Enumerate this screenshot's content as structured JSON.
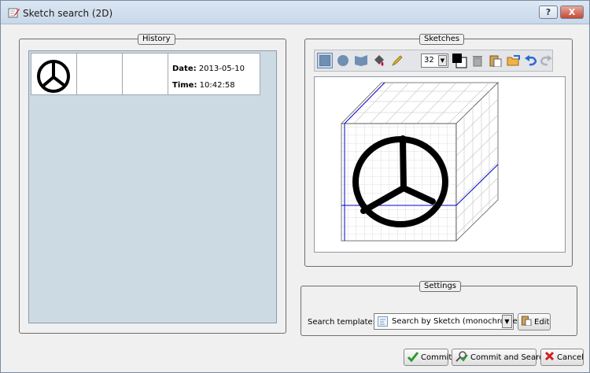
{
  "window": {
    "title": "Sketch search (2D)",
    "help_label": "?",
    "close_label": "X"
  },
  "history": {
    "title": "History",
    "items": [
      {
        "date_label": "Date:",
        "date": "2013-05-10",
        "time_label": "Time:",
        "time": "10:42:58"
      }
    ]
  },
  "sketches": {
    "title": "Sketches",
    "toolbar": {
      "tools": [
        "rectangle-tool-icon",
        "ellipse-tool-icon",
        "flag-tool-icon",
        "fill-bucket-icon",
        "pencil-icon",
        "color-picker-icon",
        "trash-icon",
        "paste-icon",
        "open-folder-icon",
        "undo-icon",
        "redo-icon"
      ],
      "brush_size": "32"
    }
  },
  "settings": {
    "title": "Settings",
    "template_label": "Search template:",
    "template_value": "Search by Sketch (monochrome)",
    "edit_label": "Edit"
  },
  "footer": {
    "commit_label": "Commit",
    "commit_search_label": "Commit and Search",
    "cancel_label": "Cancel"
  },
  "colors": {
    "accent": "#0000cc",
    "history_bg": "#ccdae4",
    "window_bg": "#f0f0f0"
  }
}
